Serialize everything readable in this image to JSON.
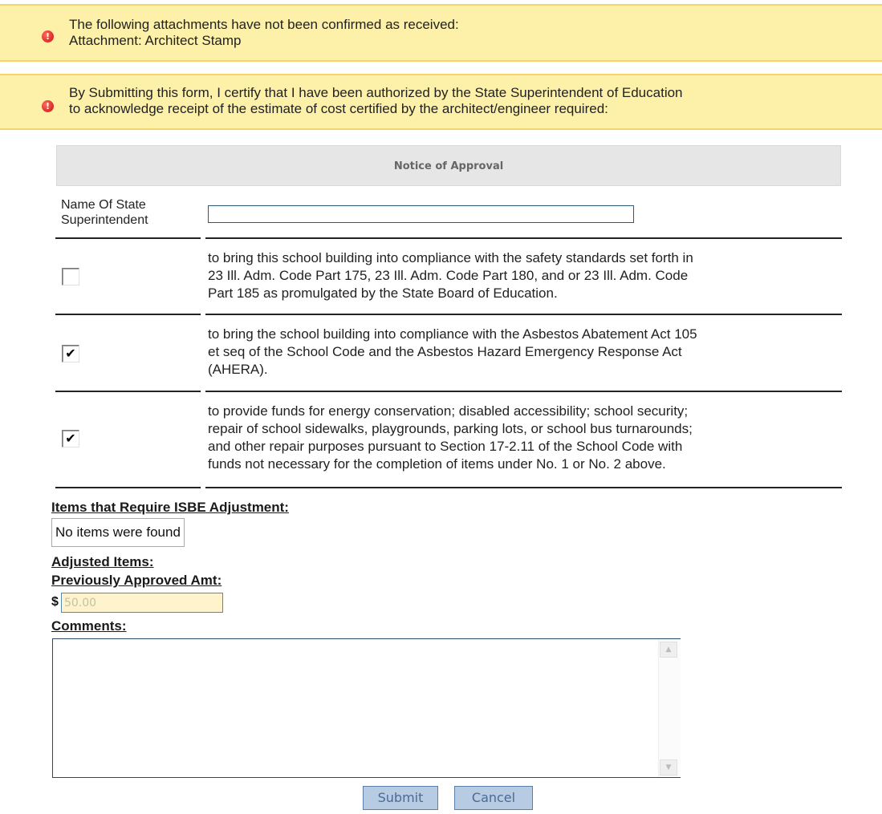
{
  "alerts": {
    "attachments": {
      "line1": "The following attachments have not been confirmed as received:",
      "line2": "Attachment: Architect Stamp",
      "icon": "error-icon"
    },
    "certify": {
      "line1": "By Submitting this form, I certify that I have been authorized by the State Superintendent of Education",
      "line2": "to acknowledge receipt of the estimate of cost certified by the architect/engineer required:",
      "icon": "error-icon"
    }
  },
  "notice": {
    "heading": "Notice of Approval",
    "superintendent_label_line1": "Name Of State",
    "superintendent_label_line2": "Superintendent",
    "superintendent_value": ""
  },
  "options": [
    {
      "checked": false,
      "lines": [
        "to bring this school building into compliance with the safety standards set forth in",
        "23 Ill. Adm. Code Part 175, 23 Ill. Adm. Code Part 180, and or 23 Ill. Adm. Code",
        "Part 185 as promulgated by the State Board of Education."
      ]
    },
    {
      "checked": true,
      "lines": [
        "to bring the school building into compliance with the Asbestos Abatement Act 105",
        "et seq of the School Code and the Asbestos Hazard Emergency Response Act",
        "(AHERA)."
      ]
    },
    {
      "checked": true,
      "lines": [
        "to provide funds for energy conservation; disabled accessibility; school security;",
        "repair of school sidewalks, playgrounds, parking lots, or school bus turnarounds;",
        "and other repair purposes pursuant to Section 17-2.11 of the School Code with",
        "funds not necessary for the completion of items under No. 1 or No. 2 above."
      ]
    }
  ],
  "adjustments": {
    "items_label": "Items that Require ISBE Adjustment:",
    "no_items_text": "No items were found",
    "adjusted_label": "Adjusted Items:",
    "previous_label": "Previously Approved Amt:",
    "currency_symbol": "$",
    "previous_value": "50.00"
  },
  "comments": {
    "label": "Comments:",
    "value": ""
  },
  "buttons": {
    "submit": "Submit",
    "cancel": "Cancel"
  }
}
